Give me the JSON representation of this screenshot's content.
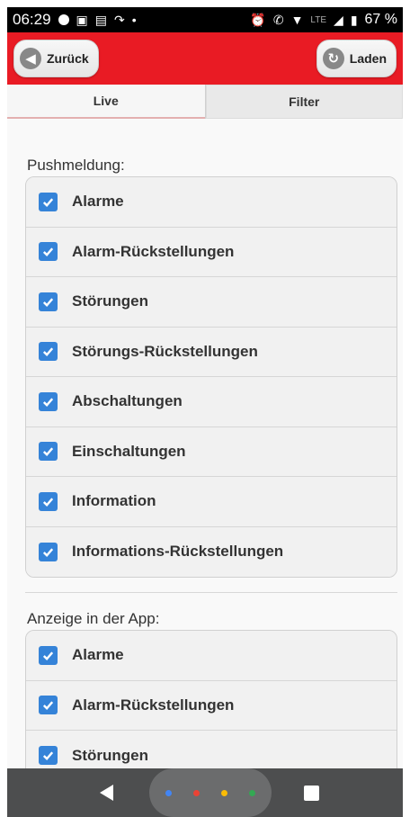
{
  "status_bar": {
    "time": "06:29",
    "battery": "67 %",
    "network": "LTE",
    "icons": [
      "circle-dot-icon",
      "notification-icon",
      "sim-icon",
      "call-icon",
      "dot-icon",
      "alarm-icon",
      "wifi-call-icon",
      "wifi-icon",
      "signal-icon",
      "battery-icon"
    ]
  },
  "header": {
    "back_label": "Zurück",
    "reload_label": "Laden",
    "color": "#e91b24"
  },
  "tabs": [
    {
      "label": "Live",
      "active": false
    },
    {
      "label": "Filter",
      "active": true
    }
  ],
  "sections": [
    {
      "title": "Pushmeldung:",
      "items": [
        {
          "label": "Alarme",
          "checked": true
        },
        {
          "label": "Alarm-Rückstellungen",
          "checked": true
        },
        {
          "label": "Störungen",
          "checked": true
        },
        {
          "label": "Störungs-Rückstellungen",
          "checked": true
        },
        {
          "label": "Abschaltungen",
          "checked": true
        },
        {
          "label": "Einschaltungen",
          "checked": true
        },
        {
          "label": "Information",
          "checked": true
        },
        {
          "label": "Informations-Rückstellungen",
          "checked": true
        }
      ]
    },
    {
      "title": "Anzeige in der App:",
      "items": [
        {
          "label": "Alarme",
          "checked": true
        },
        {
          "label": "Alarm-Rückstellungen",
          "checked": true
        },
        {
          "label": "Störungen",
          "checked": true
        }
      ]
    }
  ],
  "accent_color": "#3583d8",
  "nav": {
    "icons": [
      "back-triangle-icon",
      "home-pill-icon",
      "recents-square-icon"
    ]
  }
}
